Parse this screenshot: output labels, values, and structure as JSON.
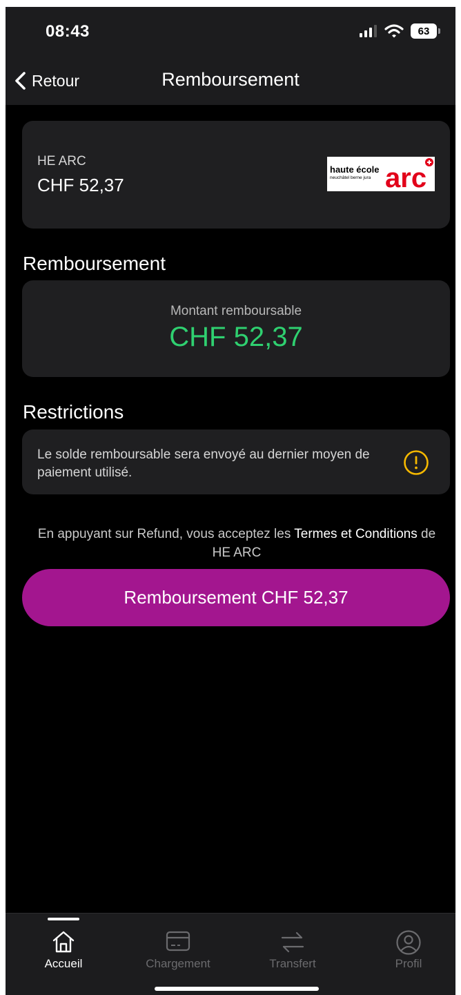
{
  "status_bar": {
    "time": "08:43",
    "battery": "63"
  },
  "nav": {
    "back_label": "Retour",
    "title": "Remboursement"
  },
  "merchant": {
    "name": "HE ARC",
    "balance": "CHF 52,37",
    "logo_text_line1": "haute école",
    "logo_text_line2": "neuchâtel berne jura",
    "logo_mark": "arc"
  },
  "refund": {
    "section_title": "Remboursement",
    "label": "Montant remboursable",
    "amount": "CHF 52,37",
    "amount_color": "#2fd070"
  },
  "restrictions": {
    "section_title": "Restrictions",
    "text": "Le solde remboursable sera envoyé au dernier moyen de paiement utilisé.",
    "warning_color": "#f5b800"
  },
  "terms": {
    "prefix": "En appuyant sur Refund, vous acceptez les ",
    "link": "Termes et Conditions",
    "suffix": " de HE ARC"
  },
  "cta": {
    "label": "Remboursement CHF 52,37",
    "color": "#a3168f"
  },
  "tabs": [
    {
      "label": "Accueil",
      "icon": "home-icon",
      "active": true
    },
    {
      "label": "Chargement",
      "icon": "card-icon",
      "active": false
    },
    {
      "label": "Transfert",
      "icon": "transfer-icon",
      "active": false
    },
    {
      "label": "Profil",
      "icon": "profile-icon",
      "active": false
    }
  ]
}
